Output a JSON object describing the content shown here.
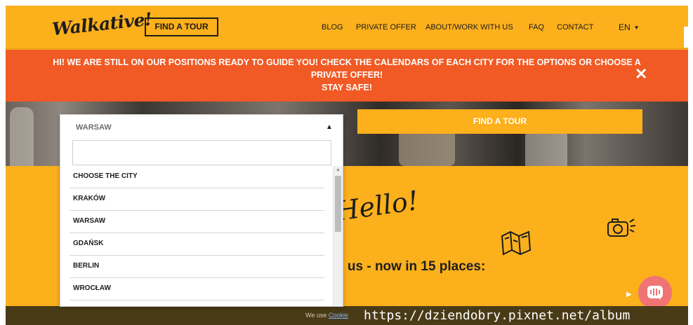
{
  "header": {
    "logo": "Walkative!",
    "find_tour": "FIND A TOUR",
    "nav": {
      "blog": "BLOG",
      "private_offer": "PRIVATE OFFER",
      "about": "ABOUT/WORK WITH US",
      "faq": "FAQ",
      "contact": "CONTACT"
    },
    "language": "EN"
  },
  "banner": {
    "line1": "HI! WE ARE STILL ON OUR POSITIONS READY TO GUIDE YOU! CHECK THE CALENDARS OF EACH CITY FOR THE OPTIONS OR CHOOSE A",
    "line2": "PRIVATE OFFER!",
    "line3": "STAY SAFE!",
    "close": "✕"
  },
  "search": {
    "find_tour_button": "FIND A TOUR",
    "city_dropdown": {
      "selected": "WARSAW",
      "search_value": "",
      "options": [
        "CHOOSE THE CITY",
        "KRAKÓW",
        "WARSAW",
        "GDAŃSK",
        "BERLIN",
        "WROCŁAW",
        "…"
      ]
    }
  },
  "content": {
    "hello": "Hello!",
    "join_text": "n us - now in 15 places:"
  },
  "footer": {
    "cookie_prefix": "We use",
    "cookie_link": "Cookie",
    "watermark": "https://dziendobry.pixnet.net/album"
  },
  "colors": {
    "brand_yellow": "#FBB01C",
    "banner_orange": "#F15A24",
    "footer_brown": "#4A3B17",
    "chat_pink": "#F07474"
  }
}
